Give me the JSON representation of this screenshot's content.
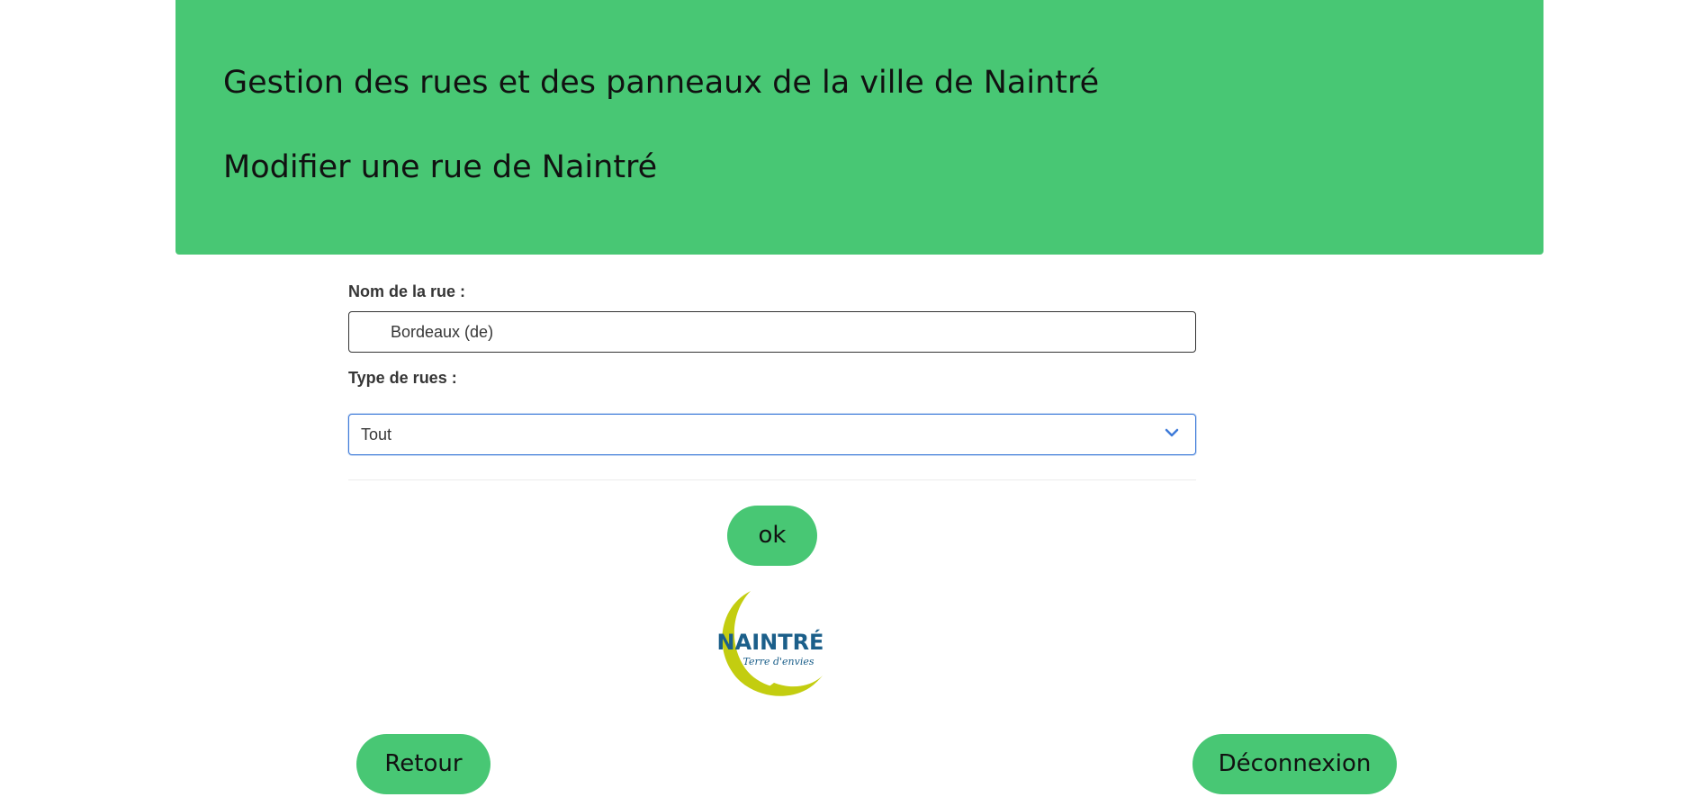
{
  "header": {
    "title": "Gestion des rues et des panneaux de la ville de Naintré",
    "subtitle": "Modifier une rue de Naintré"
  },
  "form": {
    "street_name_label": "Nom de la rue :",
    "street_name_value": "Bordeaux (de)",
    "street_type_label": "Type de rues :",
    "street_type_selected": "Tout"
  },
  "buttons": {
    "ok_label": "ok",
    "back_label": "Retour",
    "logout_label": "Déconnexion"
  },
  "logo": {
    "name": "NAINTRÉ",
    "tagline": "Terre d'envies"
  },
  "colors": {
    "accent": "#48c774",
    "logo_blue": "#1b5f8a",
    "logo_yellow": "#c3cd10",
    "focus": "#3e7bd9"
  },
  "icons": {
    "select": "chevron-down-icon"
  }
}
